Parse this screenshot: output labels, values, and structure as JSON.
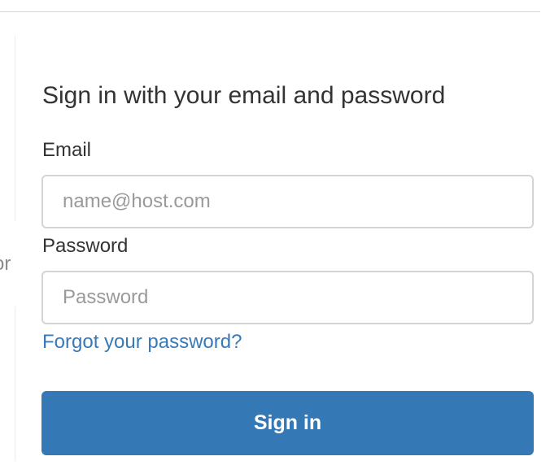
{
  "divider": {
    "or_text": "or"
  },
  "signin": {
    "heading": "Sign in with your email and password",
    "email_label": "Email",
    "email_placeholder": "name@host.com",
    "password_label": "Password",
    "password_placeholder": "Password",
    "forgot_link": "Forgot your password?",
    "submit_label": "Sign in"
  },
  "colors": {
    "primary_button": "#3578b6",
    "link": "#3979b8",
    "text": "#333333",
    "input_border": "#d4d4d4"
  }
}
